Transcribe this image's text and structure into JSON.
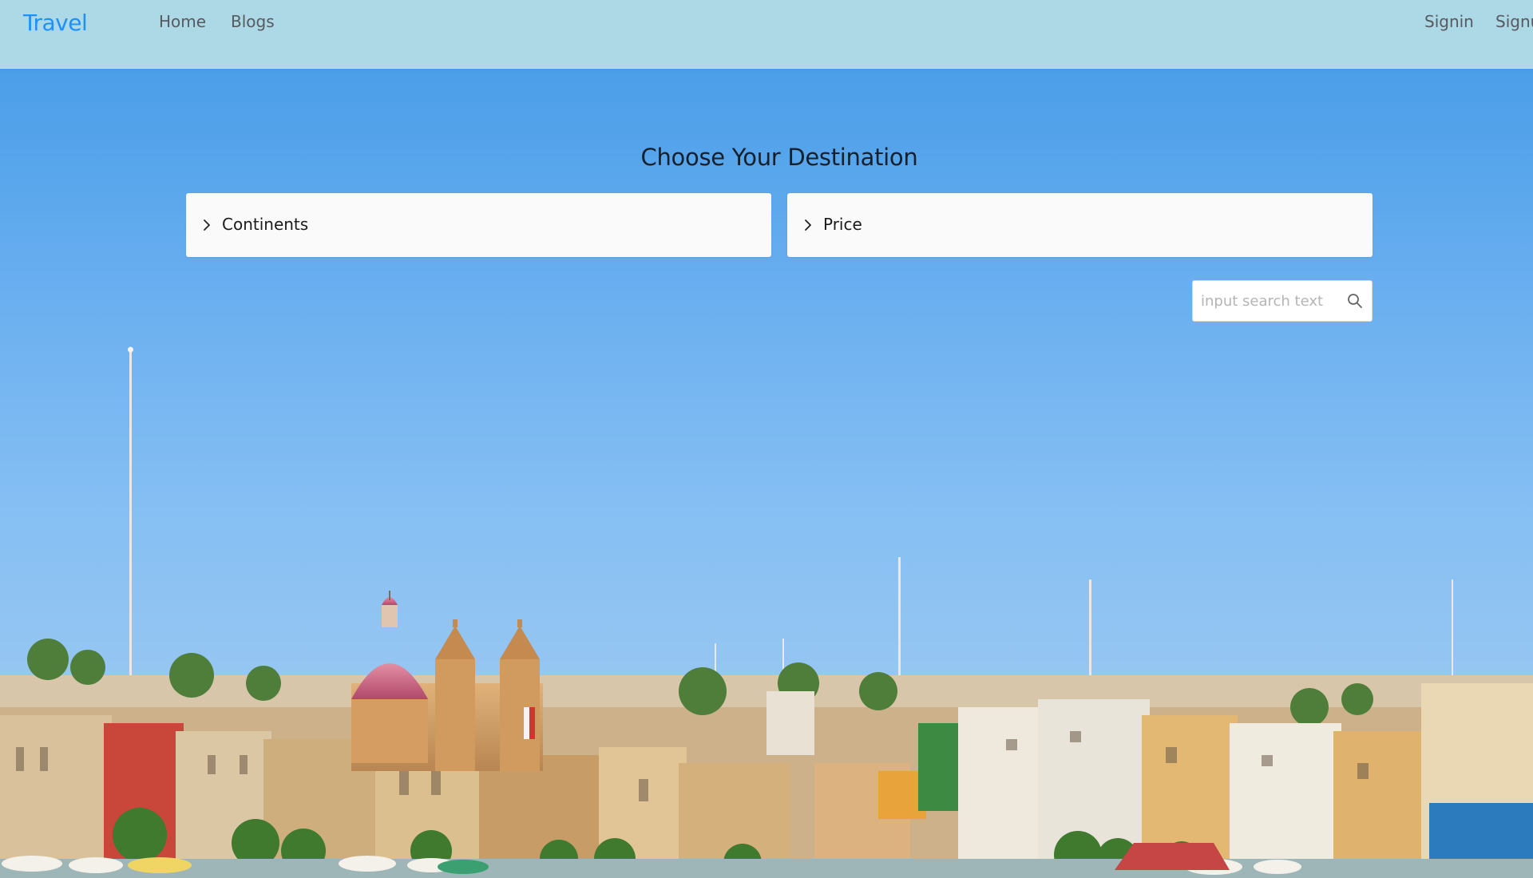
{
  "navbar": {
    "brand": "Travel",
    "links": [
      {
        "label": "Home"
      },
      {
        "label": "Blogs"
      }
    ],
    "auth": {
      "signin": "Signin",
      "signup": "Signup"
    },
    "background": "#add8e6",
    "brand_color": "#1e90ff"
  },
  "main": {
    "title": "Choose Your Destination",
    "filters": [
      {
        "label": "Continents",
        "icon": "chevron-right-icon"
      },
      {
        "label": "Price",
        "icon": "chevron-right-icon"
      }
    ],
    "search": {
      "placeholder": "input search text",
      "value": "",
      "icon": "search-icon"
    }
  },
  "hero": {
    "image": "harbour-town-with-domed-church-background"
  }
}
